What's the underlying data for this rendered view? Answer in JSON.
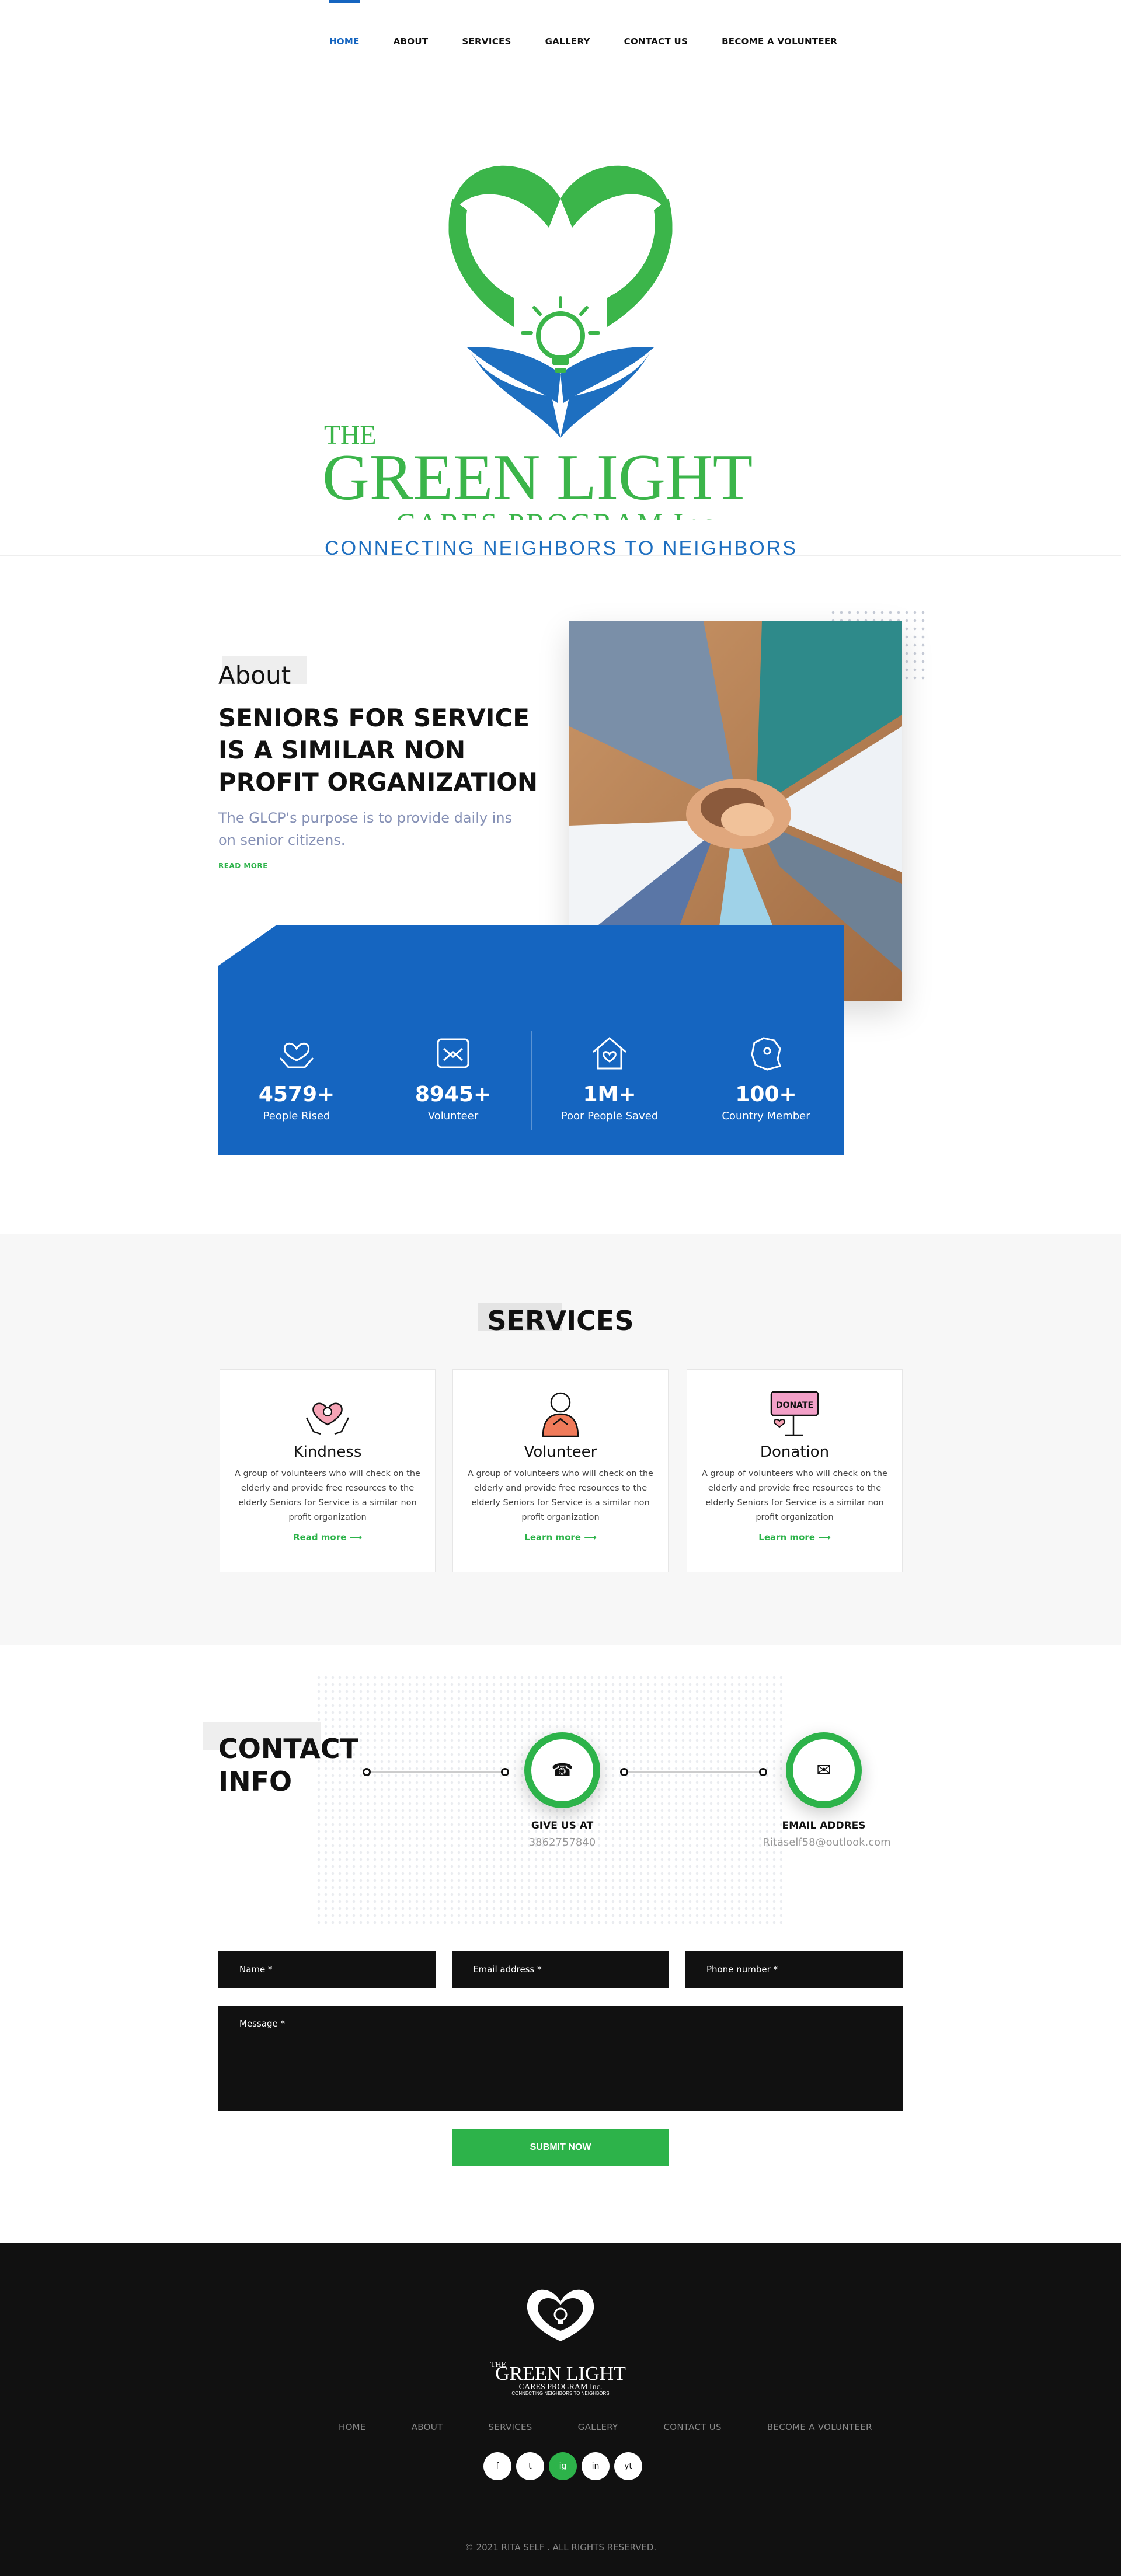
{
  "nav": {
    "items": [
      {
        "label": "HOME",
        "active": true
      },
      {
        "label": "ABOUT"
      },
      {
        "label": "SERVICES"
      },
      {
        "label": "GALLERY"
      },
      {
        "label": "CONTACT US"
      },
      {
        "label": "BECOME A VOLUNTEER"
      }
    ],
    "active_color": "#1565c0"
  },
  "logo": {
    "the": "THE",
    "name": "GREEN LIGHT",
    "program": "CARES PROGRAM Inc.",
    "tagline": "CONNECTING NEIGHBORS TO NEIGHBORS",
    "green": "#3bb54a",
    "blue": "#1e6fc0"
  },
  "about": {
    "label": "About",
    "heading": "SENIORS FOR SERVICE IS A SIMILAR NON PROFIT ORGANIZATION",
    "text": "The GLCP's purpose is to provide daily ins on senior citizens.",
    "read_more": "READ MORE",
    "stats": [
      {
        "value": "4579+",
        "label": "People Rised",
        "icon": "heart-hands-icon"
      },
      {
        "value": "8945+",
        "label": "Volunteer",
        "icon": "volunteer-hands-icon"
      },
      {
        "value": "1M+",
        "label": "Poor People Saved",
        "icon": "house-heart-icon"
      },
      {
        "value": "100+",
        "label": "Country Member",
        "icon": "country-map-icon"
      }
    ]
  },
  "services": {
    "title": "SERVICES",
    "cards": [
      {
        "name": "Kindness",
        "icon": "kindness-icon",
        "desc": "A group of volunteers who will check on the elderly and provide free resources to the elderly Seniors for Service is a similar non profit organization",
        "link": "Read more"
      },
      {
        "name": "Volunteer",
        "icon": "volunteer-icon",
        "desc": "A group of volunteers who will check on the elderly and provide free resources to the elderly Seniors for Service is a similar non profit organization",
        "link": "Learn more"
      },
      {
        "name": "Donation",
        "icon": "donate-sign-icon",
        "desc": "A group of volunteers who will check on the elderly and provide free resources to the elderly Seniors for Service is a similar non profit organization",
        "link": "Learn more",
        "sign_text": "DONATE"
      }
    ]
  },
  "contact": {
    "title_line1": "CONTACT",
    "title_line2": "INFO",
    "phone_label": "GIVE US AT",
    "phone_value": "3862757840",
    "email_label": "EMAIL ADDRES",
    "email_value": "Ritaself58@outlook.com",
    "form": {
      "name": "Name *",
      "email": "Email address *",
      "phone": "Phone number *",
      "message": "Message *",
      "submit": "SUBMIT NOW"
    },
    "accent": "#2db34a"
  },
  "footer": {
    "nav": [
      "HOME",
      "ABOUT",
      "SERVICES",
      "GALLERY",
      "CONTACT US",
      "BECOME A VOLUNTEER"
    ],
    "socials": [
      {
        "label": "f",
        "icon": "facebook-icon"
      },
      {
        "label": "t",
        "icon": "twitter-icon"
      },
      {
        "label": "ig",
        "icon": "instagram-icon",
        "active": true
      },
      {
        "label": "in",
        "icon": "linkedin-icon"
      },
      {
        "label": "yt",
        "icon": "youtube-icon"
      }
    ],
    "copyright": "© 2021 RITA SELF . ALL RIGHTS RESERVED."
  }
}
